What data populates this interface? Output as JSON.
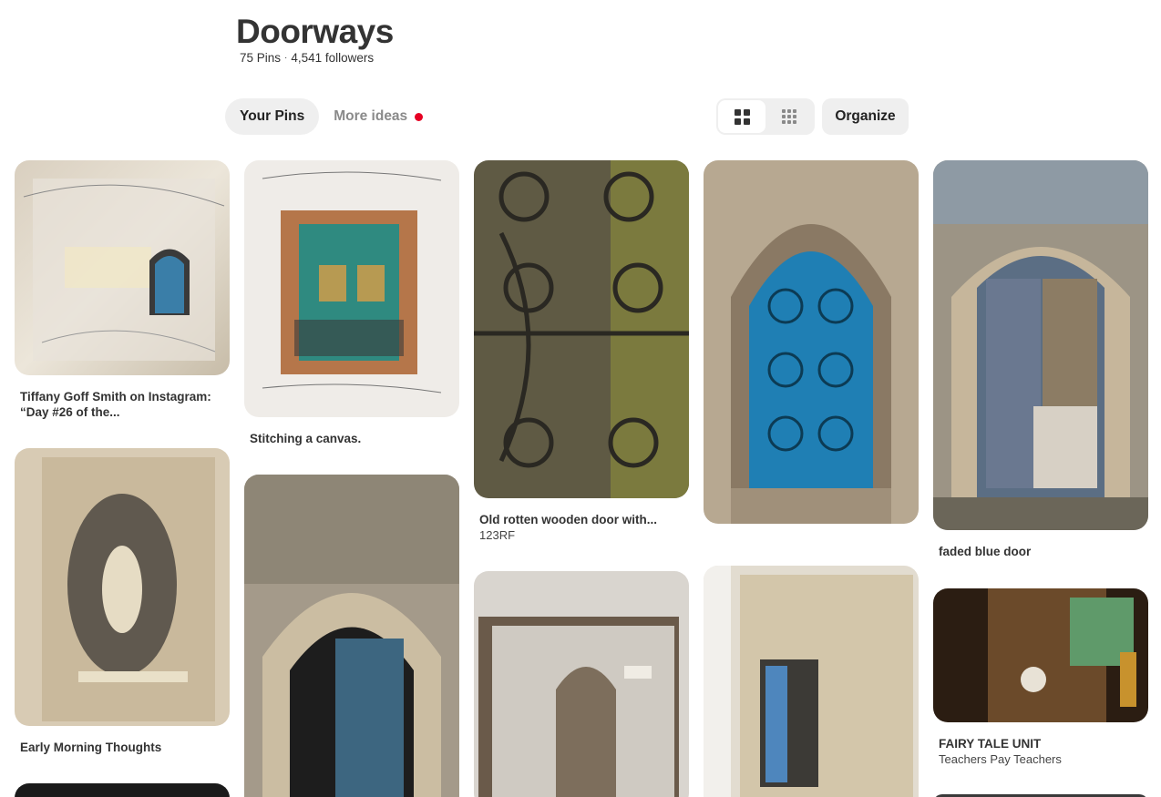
{
  "board": {
    "title": "Doorways",
    "pins_count": "75 Pins",
    "separator": "·",
    "followers": "4,541 followers"
  },
  "tabs": [
    {
      "label": "Your Pins",
      "active": true
    },
    {
      "label": "More ideas",
      "active": false,
      "notification": true
    }
  ],
  "toolbar": {
    "view_default_icon": "grid-large-icon",
    "view_compact_icon": "grid-small-icon",
    "organize_label": "Organize"
  },
  "pins": [
    {
      "title": "Tiffany Goff Smith on Instagram: “Day #26 of the...",
      "subtitle": ""
    },
    {
      "title": "Stitching a canvas.",
      "subtitle": ""
    },
    {
      "title": "Old rotten wooden door with...",
      "subtitle": "123RF"
    },
    {
      "title": "",
      "subtitle": ""
    },
    {
      "title": "faded blue door",
      "subtitle": ""
    },
    {
      "title": "Early Morning Thoughts",
      "subtitle": ""
    },
    {
      "title": "",
      "subtitle": ""
    },
    {
      "title": "",
      "subtitle": ""
    },
    {
      "title": "",
      "subtitle": ""
    },
    {
      "title": "FAIRY TALE UNIT",
      "subtitle": "Teachers Pay Teachers"
    },
    {
      "title": "",
      "subtitle": ""
    }
  ],
  "colors": {
    "accent_red": "#e60023",
    "button_bg": "#efefef"
  }
}
